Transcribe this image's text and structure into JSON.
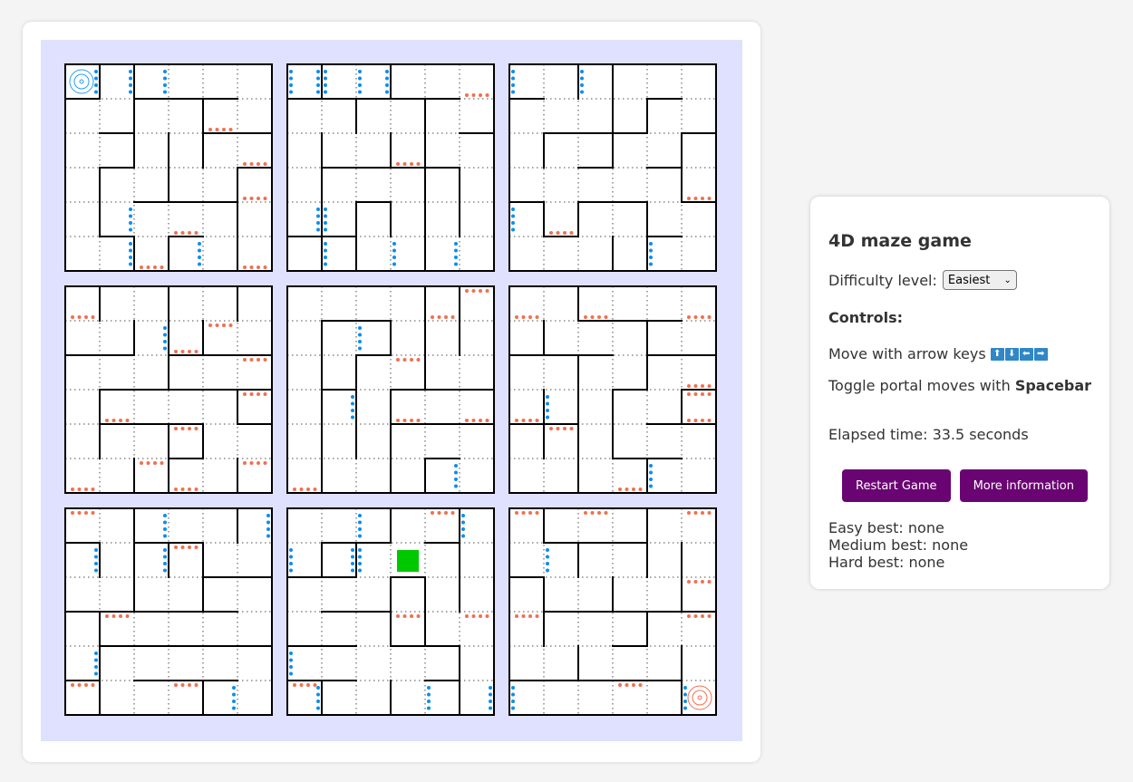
{
  "panel": {
    "title": "4D maze game",
    "difficulty_label": "Difficulty level:",
    "difficulty_value": "Easiest",
    "controls_heading": "Controls:",
    "move_text": "Move with arrow keys",
    "arrow_keys": [
      "up-arrow",
      "down-arrow",
      "left-arrow",
      "right-arrow"
    ],
    "arrow_glyphs": [
      "⬆",
      "⬇",
      "⬅",
      "➡"
    ],
    "portal_text": "Toggle portal moves with",
    "portal_key": "Spacebar",
    "elapsed_text": "Elapsed time: 33.5 seconds",
    "restart_label": "Restart Game",
    "info_label": "More information",
    "best_scores": [
      "Easy best: none",
      "Medium best: none",
      "Hard best: none"
    ]
  },
  "colors": {
    "board_bg": "#e0e0ff",
    "wall": "#000000",
    "blue_portal": "#0a8ef0",
    "orange_portal": "#f07050",
    "player": "#00c800",
    "start_marker": "#2a9df4",
    "goal_marker": "#f07050",
    "button": "#6a0472"
  },
  "maze": {
    "grid_size": 6,
    "player": {
      "maze": 7,
      "col": 3,
      "row": 1
    },
    "start": {
      "maze": 0,
      "col": 0,
      "row": 0
    },
    "goal": {
      "maze": 8,
      "col": 5,
      "row": 5
    },
    "mazes": [
      {
        "h": [
          [
            1,
            0,
            1
          ],
          [
            1,
            2,
            5
          ],
          [
            2,
            1,
            2
          ],
          [
            2,
            4,
            6
          ],
          [
            3,
            1,
            2
          ],
          [
            3,
            5,
            6
          ],
          [
            4,
            2,
            5
          ],
          [
            5,
            1,
            2
          ],
          [
            5,
            3,
            4
          ]
        ],
        "v": [
          [
            1,
            0,
            1
          ],
          [
            1,
            3,
            5
          ],
          [
            2,
            0,
            3
          ],
          [
            2,
            5,
            6
          ],
          [
            3,
            2,
            4
          ],
          [
            3,
            5,
            6
          ],
          [
            4,
            1,
            3
          ],
          [
            5,
            3,
            6
          ]
        ],
        "blue": [
          [
            0,
            0,
            "r"
          ],
          [
            1,
            0,
            "r"
          ],
          [
            2,
            0,
            "r"
          ],
          [
            1,
            4,
            "r"
          ],
          [
            1,
            5,
            "r"
          ],
          [
            3,
            5,
            "r"
          ]
        ],
        "orange": [
          [
            4,
            1,
            "b"
          ],
          [
            5,
            2,
            "b"
          ],
          [
            5,
            3,
            "b"
          ],
          [
            3,
            4,
            "b"
          ],
          [
            2,
            5,
            "b"
          ],
          [
            5,
            5,
            "b"
          ]
        ]
      },
      {
        "h": [
          [
            1,
            0,
            5
          ],
          [
            2,
            5,
            6
          ],
          [
            3,
            1,
            5
          ],
          [
            4,
            2,
            3
          ],
          [
            5,
            0,
            2
          ]
        ],
        "v": [
          [
            1,
            0,
            1
          ],
          [
            1,
            2,
            6
          ],
          [
            2,
            1,
            2
          ],
          [
            2,
            4,
            6
          ],
          [
            3,
            0,
            1
          ],
          [
            3,
            2,
            3
          ],
          [
            3,
            4,
            5
          ],
          [
            4,
            1,
            6
          ],
          [
            5,
            3,
            5
          ]
        ],
        "blue": [
          [
            0,
            0,
            "l"
          ],
          [
            0,
            0,
            "r"
          ],
          [
            1,
            0,
            "l"
          ],
          [
            2,
            0,
            "l"
          ],
          [
            2,
            0,
            "r"
          ],
          [
            0,
            4,
            "r"
          ],
          [
            1,
            4,
            "l"
          ],
          [
            1,
            5,
            "l"
          ],
          [
            3,
            5,
            "l"
          ],
          [
            4,
            5,
            "r"
          ]
        ],
        "orange": [
          [
            5,
            0,
            "b"
          ],
          [
            3,
            2,
            "b"
          ]
        ]
      },
      {
        "h": [
          [
            1,
            0,
            1
          ],
          [
            1,
            4,
            5
          ],
          [
            2,
            1,
            4
          ],
          [
            2,
            5,
            6
          ],
          [
            3,
            2,
            3
          ],
          [
            3,
            4,
            5
          ],
          [
            4,
            0,
            1
          ],
          [
            4,
            2,
            4
          ],
          [
            4,
            5,
            6
          ],
          [
            5,
            1,
            2
          ],
          [
            5,
            4,
            5
          ]
        ],
        "v": [
          [
            1,
            2,
            3
          ],
          [
            1,
            4,
            5
          ],
          [
            2,
            0,
            1
          ],
          [
            2,
            4,
            5
          ],
          [
            3,
            0,
            3
          ],
          [
            3,
            5,
            6
          ],
          [
            4,
            1,
            2
          ],
          [
            4,
            4,
            6
          ],
          [
            5,
            2,
            4
          ]
        ],
        "blue": [
          [
            0,
            0,
            "l"
          ],
          [
            2,
            0,
            "l"
          ],
          [
            0,
            4,
            "l"
          ],
          [
            4,
            5,
            "l"
          ]
        ],
        "orange": [
          [
            5,
            3,
            "b"
          ],
          [
            1,
            4,
            "b"
          ]
        ]
      },
      {
        "h": [
          [
            2,
            0,
            2
          ],
          [
            2,
            3,
            6
          ],
          [
            3,
            1,
            6
          ],
          [
            4,
            1,
            4
          ],
          [
            4,
            5,
            6
          ],
          [
            5,
            3,
            4
          ]
        ],
        "v": [
          [
            1,
            0,
            1
          ],
          [
            1,
            3,
            5
          ],
          [
            2,
            1,
            2
          ],
          [
            2,
            5,
            6
          ],
          [
            3,
            0,
            3
          ],
          [
            3,
            4,
            6
          ],
          [
            4,
            1,
            2
          ],
          [
            4,
            4,
            5
          ],
          [
            5,
            0,
            1
          ],
          [
            5,
            3,
            4
          ],
          [
            5,
            5,
            6
          ]
        ],
        "blue": [
          [
            2,
            1,
            "r"
          ]
        ],
        "orange": [
          [
            0,
            0,
            "b"
          ],
          [
            4,
            1,
            "t"
          ],
          [
            3,
            1,
            "b"
          ],
          [
            5,
            2,
            "t"
          ],
          [
            5,
            3,
            "t"
          ],
          [
            1,
            3,
            "b"
          ],
          [
            3,
            4,
            "t"
          ],
          [
            2,
            5,
            "t"
          ],
          [
            5,
            5,
            "t"
          ],
          [
            0,
            5,
            "b"
          ],
          [
            3,
            5,
            "b"
          ]
        ]
      },
      {
        "h": [
          [
            1,
            1,
            3
          ],
          [
            2,
            2,
            3
          ],
          [
            3,
            1,
            2
          ],
          [
            3,
            3,
            6
          ],
          [
            4,
            3,
            6
          ],
          [
            5,
            4,
            5
          ]
        ],
        "v": [
          [
            1,
            1,
            6
          ],
          [
            2,
            2,
            5
          ],
          [
            3,
            1,
            2
          ],
          [
            3,
            3,
            6
          ],
          [
            4,
            0,
            3
          ],
          [
            4,
            5,
            6
          ],
          [
            5,
            0,
            2
          ]
        ],
        "blue": [
          [
            2,
            1,
            "l"
          ],
          [
            1,
            3,
            "r"
          ],
          [
            4,
            5,
            "r"
          ]
        ],
        "orange": [
          [
            5,
            0,
            "t"
          ],
          [
            4,
            0,
            "b"
          ],
          [
            3,
            2,
            "t"
          ],
          [
            3,
            3,
            "b"
          ],
          [
            5,
            3,
            "b"
          ],
          [
            0,
            5,
            "b"
          ]
        ]
      },
      {
        "h": [
          [
            1,
            2,
            5
          ],
          [
            2,
            0,
            3
          ],
          [
            2,
            4,
            6
          ],
          [
            3,
            3,
            4
          ],
          [
            3,
            5,
            6
          ],
          [
            4,
            0,
            2
          ],
          [
            4,
            4,
            6
          ],
          [
            5,
            3,
            5
          ]
        ],
        "v": [
          [
            1,
            1,
            2
          ],
          [
            1,
            3,
            5
          ],
          [
            2,
            0,
            1
          ],
          [
            2,
            2,
            6
          ],
          [
            3,
            3,
            5
          ],
          [
            4,
            1,
            3
          ],
          [
            4,
            5,
            6
          ],
          [
            5,
            3,
            4
          ]
        ],
        "blue": [
          [
            1,
            3,
            "l"
          ],
          [
            4,
            5,
            "l"
          ]
        ],
        "orange": [
          [
            0,
            0,
            "b"
          ],
          [
            2,
            0,
            "b"
          ],
          [
            5,
            0,
            "b"
          ],
          [
            5,
            2,
            "b"
          ],
          [
            5,
            3,
            "t"
          ],
          [
            5,
            3,
            "b"
          ],
          [
            0,
            3,
            "b"
          ],
          [
            1,
            4,
            "t"
          ],
          [
            3,
            5,
            "b"
          ]
        ]
      },
      {
        "h": [
          [
            1,
            0,
            1
          ],
          [
            1,
            2,
            4
          ],
          [
            2,
            4,
            6
          ],
          [
            3,
            0,
            5
          ],
          [
            4,
            1,
            6
          ],
          [
            5,
            0,
            1
          ],
          [
            5,
            2,
            5
          ]
        ],
        "v": [
          [
            1,
            1,
            2
          ],
          [
            1,
            3,
            6
          ],
          [
            2,
            0,
            3
          ],
          [
            3,
            1,
            2
          ],
          [
            4,
            1,
            3
          ],
          [
            4,
            5,
            6
          ],
          [
            5,
            0,
            1
          ]
        ],
        "blue": [
          [
            2,
            0,
            "r"
          ],
          [
            5,
            0,
            "r"
          ],
          [
            0,
            1,
            "r"
          ],
          [
            2,
            1,
            "r"
          ],
          [
            0,
            4,
            "r"
          ],
          [
            4,
            5,
            "r"
          ]
        ],
        "orange": [
          [
            0,
            0,
            "t"
          ],
          [
            3,
            1,
            "t"
          ],
          [
            1,
            3,
            "t"
          ],
          [
            0,
            5,
            "t"
          ],
          [
            3,
            5,
            "t"
          ]
        ]
      },
      {
        "h": [
          [
            1,
            1,
            3
          ],
          [
            1,
            4,
            5
          ],
          [
            2,
            0,
            2
          ],
          [
            2,
            3,
            4
          ],
          [
            3,
            1,
            3
          ],
          [
            4,
            0,
            2
          ],
          [
            4,
            3,
            5
          ],
          [
            5,
            0,
            2
          ],
          [
            5,
            4,
            5
          ]
        ],
        "v": [
          [
            1,
            1,
            2
          ],
          [
            1,
            5,
            6
          ],
          [
            2,
            1,
            2
          ],
          [
            3,
            0,
            1
          ],
          [
            3,
            2,
            4
          ],
          [
            3,
            5,
            6
          ],
          [
            4,
            2,
            4
          ],
          [
            5,
            0,
            3
          ],
          [
            5,
            4,
            6
          ]
        ],
        "blue": [
          [
            2,
            0,
            "l"
          ],
          [
            5,
            0,
            "l"
          ],
          [
            0,
            1,
            "l"
          ],
          [
            1,
            1,
            "r"
          ],
          [
            2,
            1,
            "l"
          ],
          [
            0,
            4,
            "l"
          ],
          [
            0,
            5,
            "r"
          ],
          [
            4,
            5,
            "l"
          ],
          [
            5,
            5,
            "r"
          ]
        ],
        "orange": [
          [
            4,
            0,
            "t"
          ],
          [
            3,
            3,
            "t"
          ],
          [
            5,
            3,
            "t"
          ],
          [
            0,
            5,
            "t"
          ]
        ]
      },
      {
        "h": [
          [
            1,
            1,
            4
          ],
          [
            2,
            0,
            1
          ],
          [
            3,
            1,
            6
          ],
          [
            4,
            3,
            4
          ],
          [
            5,
            0,
            5
          ]
        ],
        "v": [
          [
            1,
            0,
            1
          ],
          [
            1,
            2,
            4
          ],
          [
            2,
            1,
            2
          ],
          [
            2,
            4,
            5
          ],
          [
            3,
            2,
            3
          ],
          [
            4,
            0,
            2
          ],
          [
            4,
            3,
            4
          ],
          [
            5,
            1,
            3
          ],
          [
            5,
            4,
            6
          ]
        ],
        "blue": [
          [
            1,
            1,
            "l"
          ],
          [
            0,
            5,
            "l"
          ],
          [
            5,
            5,
            "l"
          ]
        ],
        "orange": [
          [
            0,
            0,
            "t"
          ],
          [
            2,
            0,
            "t"
          ],
          [
            5,
            0,
            "t"
          ],
          [
            5,
            2,
            "t"
          ],
          [
            0,
            3,
            "t"
          ],
          [
            5,
            3,
            "t"
          ],
          [
            3,
            5,
            "t"
          ]
        ]
      }
    ]
  }
}
